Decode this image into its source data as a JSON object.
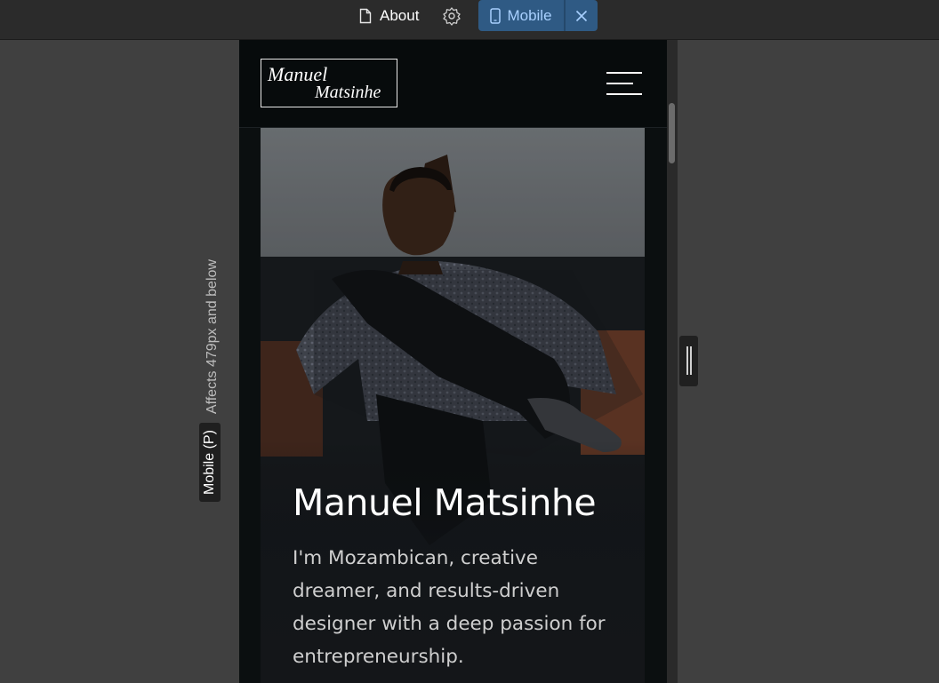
{
  "toolbar": {
    "page_name": "About",
    "page_icon": "page-icon",
    "settings_icon": "gear-icon",
    "breakpoint_label": "Mobile",
    "breakpoint_icon": "mobile-device-icon",
    "close_icon": "close-icon"
  },
  "side_label": {
    "breakpoint": "Mobile (P)",
    "affects": "Affects 479px and below"
  },
  "site": {
    "logo_line1": "Manuel",
    "logo_line2": "Matsinhe",
    "menu_icon": "hamburger-menu-icon",
    "hero_title": "Manuel Matsinhe",
    "hero_text": "I'm Mozambican, creative dreamer, and results-driven designer with a deep passion for entrepreneurship."
  },
  "colors": {
    "toolbar_bg": "#2b2b2b",
    "canvas_bg": "#404040",
    "accent_pill": "#2f5a84",
    "accent_text": "#a8d0ff",
    "site_bg": "#0b0f10"
  }
}
